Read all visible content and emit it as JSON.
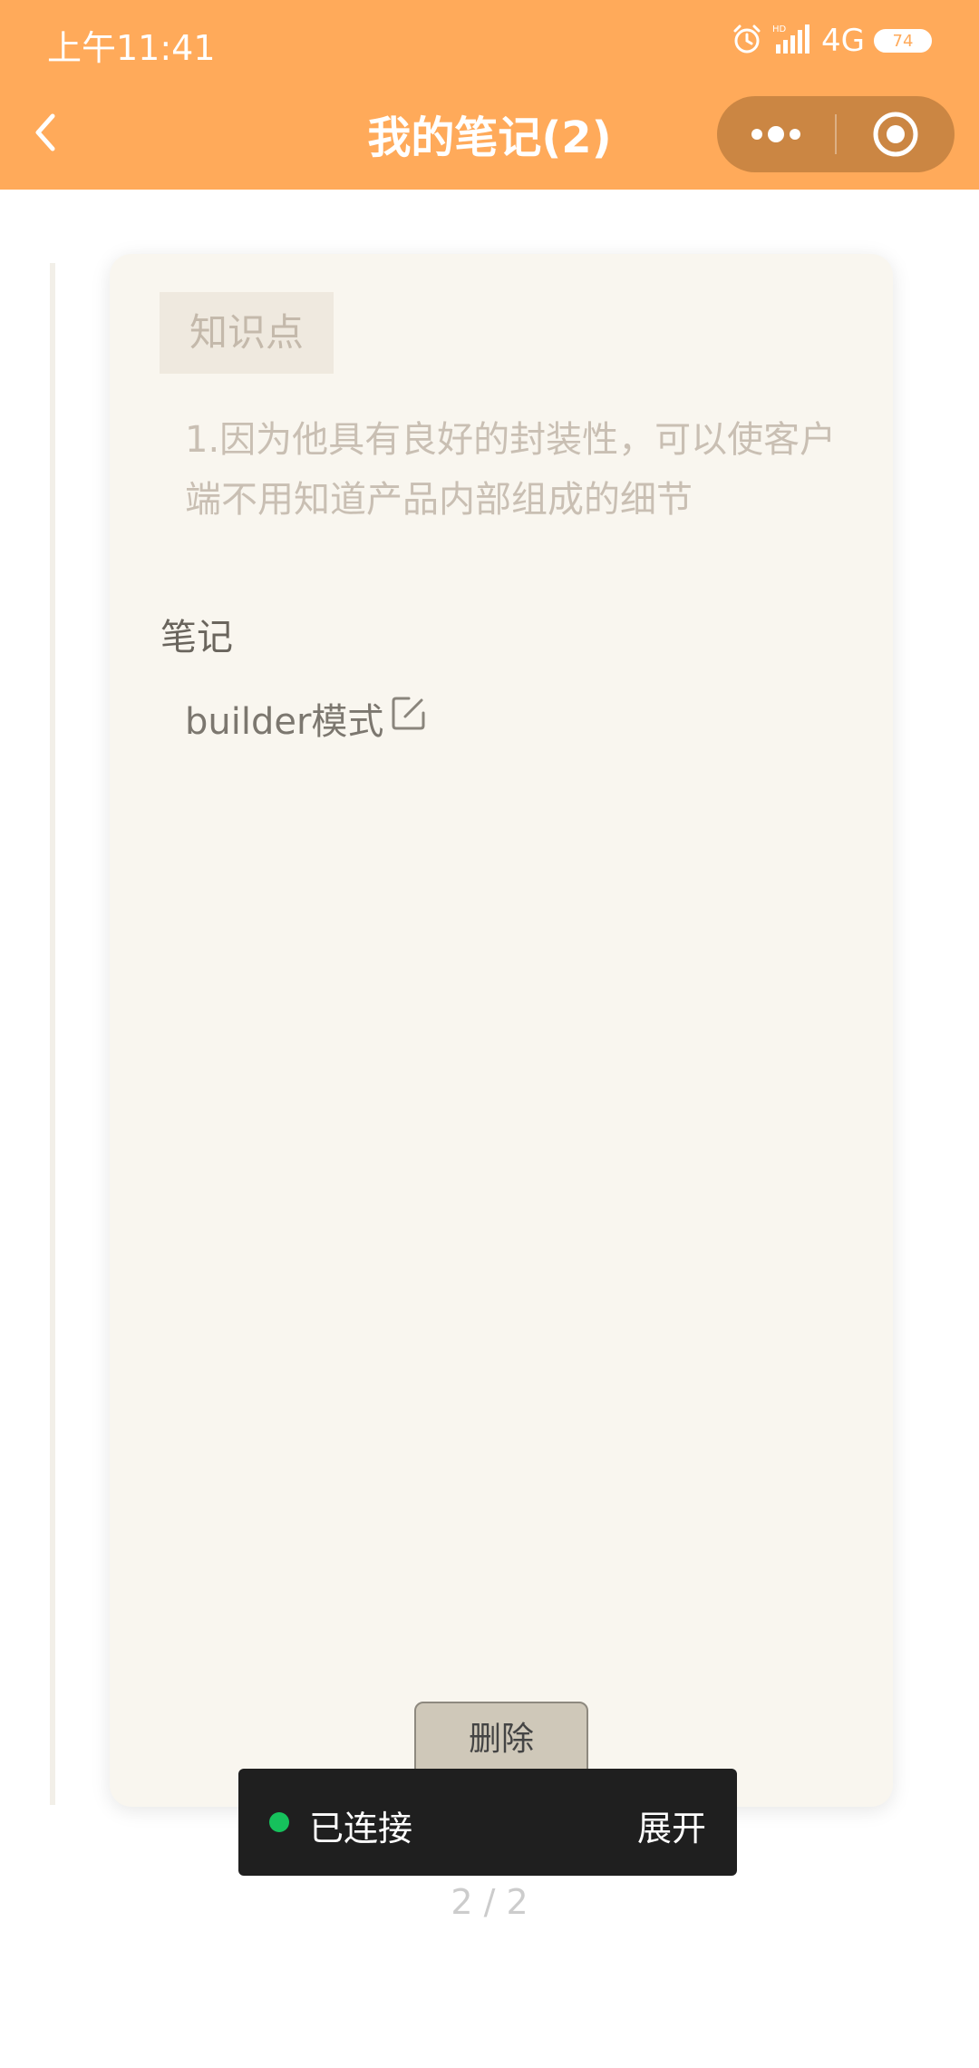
{
  "status_bar": {
    "time": "上午11:41",
    "network": "4G",
    "battery": "74",
    "icons": [
      "alarm-icon",
      "hd-icon",
      "signal-icon",
      "battery-icon"
    ]
  },
  "nav": {
    "title": "我的笔记(2)",
    "back_icon": "chevron-left-icon",
    "more_icon": "more-dots-icon",
    "close_icon": "target-circle-icon",
    "bar_color": "#ffaa5a"
  },
  "card": {
    "tag": "知识点",
    "knowledge_text": "1.因为他具有良好的封装性，可以使客户端不用知道产品内部组成的细节",
    "section_label": "笔记",
    "note_text": "builder模式",
    "edit_icon": "edit-icon",
    "delete_label": "删除"
  },
  "toast": {
    "status": "已连接",
    "expand_label": "展开",
    "dot_color": "#16c15c"
  },
  "pager": {
    "text": "2 / 2"
  }
}
